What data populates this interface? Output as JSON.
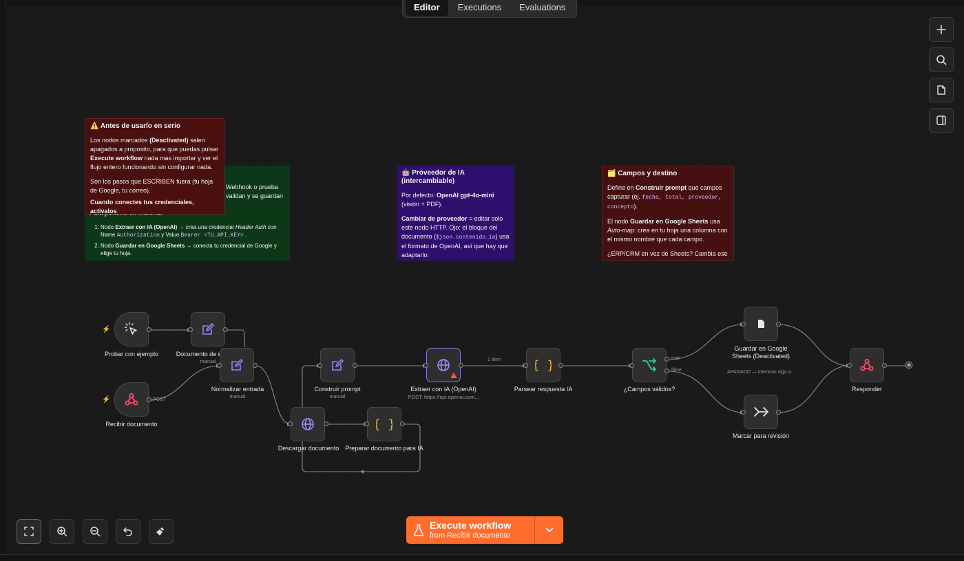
{
  "tabs": [
    "Editor",
    "Executions",
    "Evaluations"
  ],
  "active_tab": "Editor",
  "right_toolbar": [
    "plus-icon",
    "search-icon",
    "sticky-note-icon",
    "panel-icon"
  ],
  "bottom_toolbar": [
    "fit-view-icon",
    "zoom-in-icon",
    "zoom-out-icon",
    "undo-icon",
    "clear-icon"
  ],
  "notes": {
    "red": {
      "title": "⚠️ Antes de usarlo en serio",
      "p1_pre": "Los nodos marcados ",
      "p1_b1": "(Deactivated)",
      "p1_mid": " salen apagados a proposito, para que puedas pulsar ",
      "p1_b2": "Execute workflow",
      "p1_post": " nada mas importar y ver el flujo entero funcionando sin configurar nada.",
      "p2": "Son los pasos que ESCRIBEN fuera (tu hoja de Google, tu correo).",
      "p3": "Cuando conectes tus credenciales, activalos"
    },
    "green": {
      "line1": "Webhook o prueba",
      "line2": "validan y se guardan",
      "heading": "Para ponerlo en marcha:",
      "item1_a": "Nodo ",
      "item1_b": "Extraer con IA (OpenAI)",
      "item1_c": " → crea una credencial ",
      "item1_d": "Header Auth",
      "item1_e": " con Name ",
      "item1_code1": "Authorization",
      "item1_f": " y Value ",
      "item1_code2": "Bearer <TU_API_KEY>",
      "item1_g": " .",
      "item2_a": "Nodo ",
      "item2_b": "Guardar en Google Sheets",
      "item2_c": " → conecta tu credencial de Google y elige tu hoja."
    },
    "purple": {
      "title": "🤖 Proveedor de IA (intercambiable)",
      "p1_pre": "Por defecto: ",
      "p1_b": "OpenAI gpt-4o-mini",
      "p1_post": " (visión + PDF).",
      "p2_b": "Cambiar de proveedor",
      "p2_a": " = editar solo este nodo HTTP. Ojo: el bloque del documento (",
      "p2_code": "$json.contenido_ia",
      "p2_c": ") usa el formato de OpenAI, así que hay que adaptarlo:"
    },
    "brown": {
      "title": "🗂️ Campos y destino",
      "p1_a": "Define en ",
      "p1_b": "Construir prompt",
      "p1_c": " qué campos capturar (ej. ",
      "p1_code": "fecha, total, proveedor, concepto",
      "p1_d": ").",
      "p2_a": "El nodo ",
      "p2_b": "Guardar en Google Sheets",
      "p2_c": " usa ",
      "p2_i": "Auto-map",
      "p2_d": ": crea en tu hoja una columna con el mismo nombre que cada campo.",
      "p3": "¿ERP/CRM en vez de Sheets? Cambia ese"
    }
  },
  "nodes": {
    "probar": {
      "label": "Probar con ejemplo",
      "icon": "cursor-click-icon"
    },
    "recibir": {
      "label": "Recibir documento",
      "icon": "webhook-icon",
      "port_label": "POST"
    },
    "doc_ejemplo": {
      "label": "Documento de ejemplo",
      "sub": "manual",
      "icon": "edit-icon"
    },
    "normalizar": {
      "label": "Normalizar entrada",
      "sub": "manual",
      "icon": "edit-icon"
    },
    "descargar": {
      "label": "Descargar documento",
      "icon": "globe-icon"
    },
    "preparar": {
      "label": "Preparar documento para IA",
      "icon": "code-braces-icon"
    },
    "construir": {
      "label": "Construir prompt",
      "sub": "manual",
      "icon": "edit-icon"
    },
    "extraer": {
      "label": "Extraer con IA (OpenAI)",
      "sub": "POST: https://api.openai.com...",
      "icon": "globe-icon"
    },
    "parsear": {
      "label": "Parsear respuesta IA",
      "icon": "code-braces-icon"
    },
    "campos": {
      "label": "¿Campos válidos?",
      "icon": "branch-icon",
      "true_label": "true",
      "false_label": "false"
    },
    "guardar": {
      "label": "Guardar en Google Sheets (Deactivated)",
      "sub": "APAGADO — mientras siga a...",
      "icon": "sheets-icon"
    },
    "marcar": {
      "label": "Marcar para revisión",
      "icon": "arrow-right-icon"
    },
    "responder": {
      "label": "Responder",
      "icon": "webhook-icon"
    }
  },
  "edge_labels": {
    "extraer_parsear": "1 item"
  },
  "execute": {
    "title": "Execute workflow",
    "subtitle": "from Recibir documento"
  },
  "colors": {
    "accent": "#ff6d2d",
    "note_red": "#4a0f0f",
    "note_green": "#0c3818",
    "note_purple": "#2f0f6e",
    "note_brown": "#461010"
  }
}
